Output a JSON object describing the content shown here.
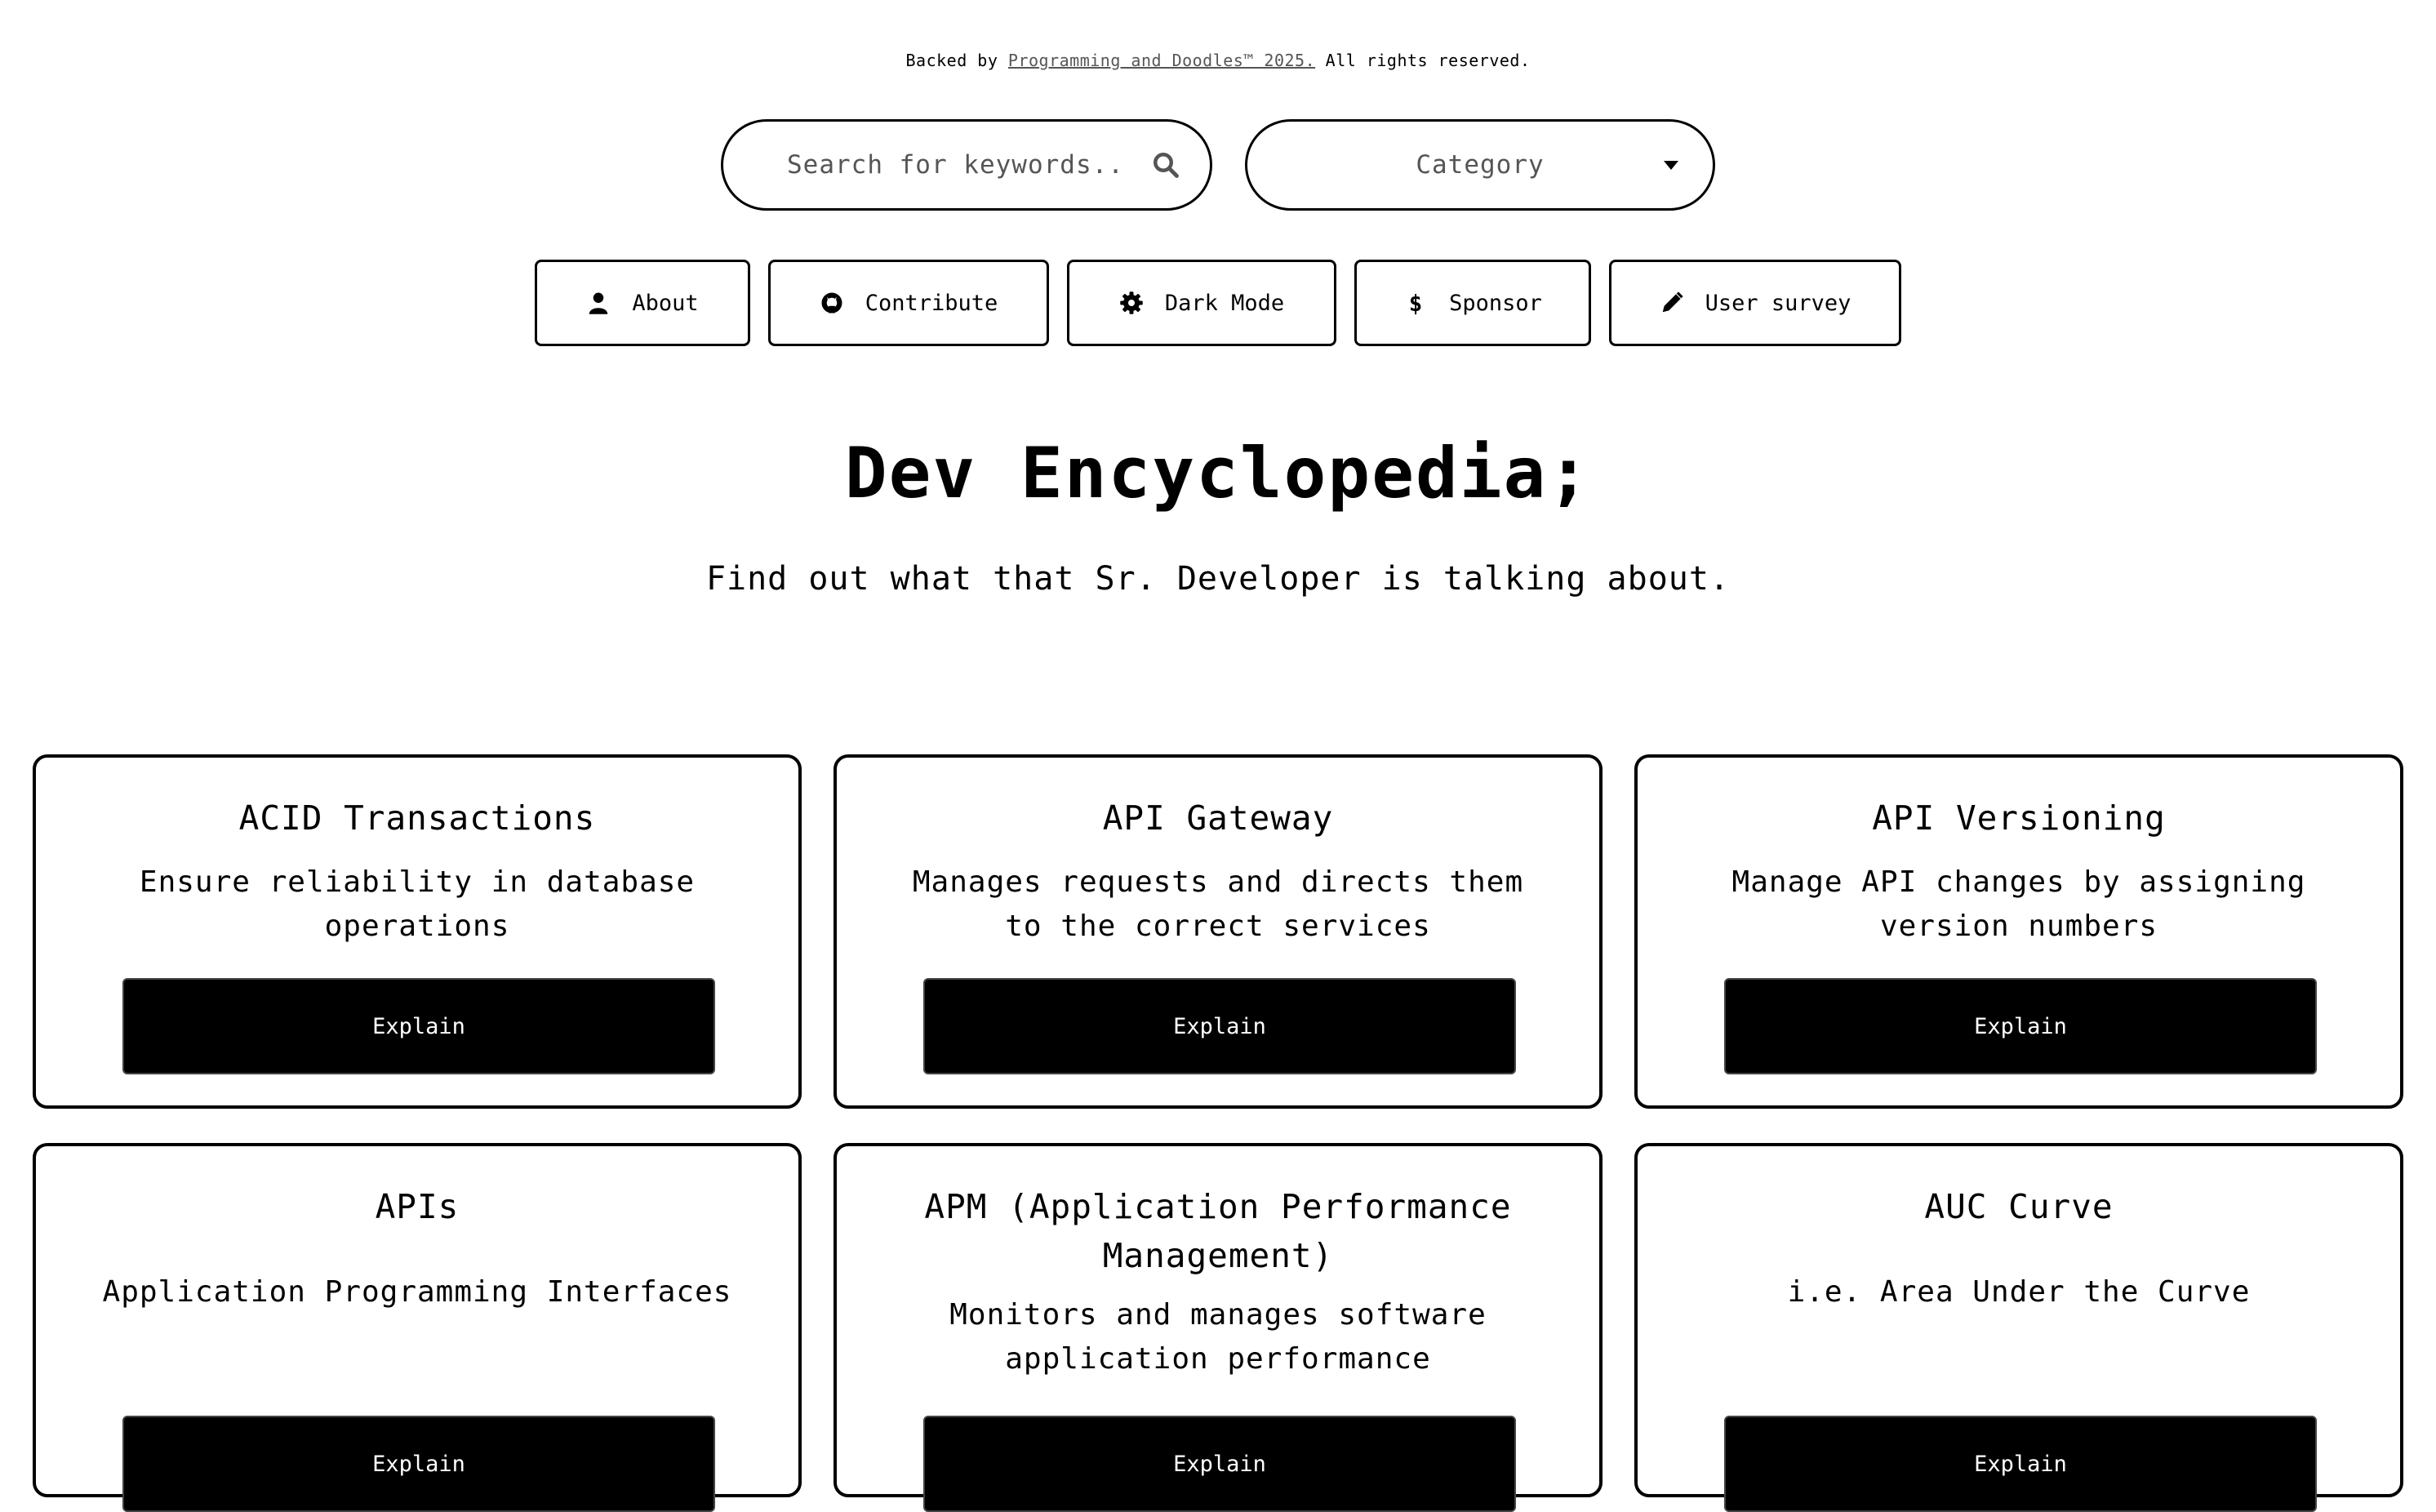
{
  "footer": {
    "prefix": "Backed by ",
    "link": "Programming and Doodles™ 2025.",
    "suffix": " All rights reserved."
  },
  "search": {
    "placeholder": "Search for keywords.."
  },
  "category": {
    "label": "Category"
  },
  "nav": {
    "about": "About",
    "contribute": "Contribute",
    "dark_mode": "Dark Mode",
    "sponsor": "Sponsor",
    "user_survey": "User survey"
  },
  "page": {
    "title": "Dev Encyclopedia;",
    "subtitle": "Find out what that Sr. Developer is talking about."
  },
  "cards": [
    {
      "title": "ACID Transactions",
      "desc": "Ensure reliability in database operations",
      "button": "Explain"
    },
    {
      "title": "API Gateway",
      "desc": "Manages requests and directs them to the correct services",
      "button": "Explain"
    },
    {
      "title": "API Versioning",
      "desc": "Manage API changes by assigning version numbers",
      "button": "Explain"
    },
    {
      "title": "APIs",
      "desc": "Application Programming Interfaces",
      "button": "Explain"
    },
    {
      "title": "APM (Application Performance Management)",
      "desc": "Monitors and manages software application performance",
      "button": "Explain"
    },
    {
      "title": "AUC Curve",
      "desc": "i.e. Area Under the Curve",
      "button": "Explain"
    }
  ]
}
